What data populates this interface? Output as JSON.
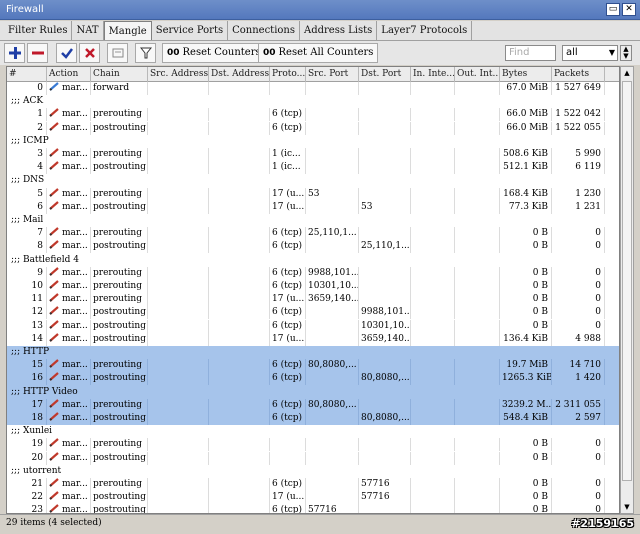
{
  "window": {
    "title": "Firewall"
  },
  "tabs": [
    {
      "label": "Filter Rules",
      "active": false
    },
    {
      "label": "NAT",
      "active": false
    },
    {
      "label": "Mangle",
      "active": true
    },
    {
      "label": "Service Ports",
      "active": false
    },
    {
      "label": "Connections",
      "active": false
    },
    {
      "label": "Address Lists",
      "active": false
    },
    {
      "label": "Layer7 Protocols",
      "active": false
    }
  ],
  "toolbar": {
    "reset_counters_badge": "00",
    "reset_counters_label": "Reset Counters",
    "reset_all_badge": "00",
    "reset_all_label": "Reset All Counters",
    "find_placeholder": "Find",
    "filter_value": "all"
  },
  "columns": [
    "#",
    "Action",
    "Chain",
    "Src. Address",
    "Dst. Address",
    "Proto...",
    "Src. Port",
    "Dst. Port",
    "In. Inte...",
    "Out. Int...",
    "Bytes",
    "Packets"
  ],
  "rows": [
    {
      "type": "rule",
      "num": "0",
      "action": "mar...",
      "chain": "forward",
      "proto": "",
      "src_port": "",
      "dst_port": "",
      "bytes": "67.0 MiB",
      "packets": "1 527 649",
      "selected": false,
      "icon": "blue"
    },
    {
      "type": "comment",
      "text": ";;; ACK",
      "selected": false
    },
    {
      "type": "rule",
      "num": "1",
      "action": "mar...",
      "chain": "prerouting",
      "proto": "6 (tcp)",
      "src_port": "",
      "dst_port": "",
      "bytes": "66.0 MiB",
      "packets": "1 522 042",
      "selected": false
    },
    {
      "type": "rule",
      "num": "2",
      "action": "mar...",
      "chain": "postrouting",
      "proto": "6 (tcp)",
      "src_port": "",
      "dst_port": "",
      "bytes": "66.0 MiB",
      "packets": "1 522 055",
      "selected": false
    },
    {
      "type": "comment",
      "text": ";;; ICMP",
      "selected": false
    },
    {
      "type": "rule",
      "num": "3",
      "action": "mar...",
      "chain": "prerouting",
      "proto": "1 (ic...",
      "src_port": "",
      "dst_port": "",
      "bytes": "508.6 KiB",
      "packets": "5 990",
      "selected": false
    },
    {
      "type": "rule",
      "num": "4",
      "action": "mar...",
      "chain": "postrouting",
      "proto": "1 (ic...",
      "src_port": "",
      "dst_port": "",
      "bytes": "512.1 KiB",
      "packets": "6 119",
      "selected": false
    },
    {
      "type": "comment",
      "text": ";;; DNS",
      "selected": false
    },
    {
      "type": "rule",
      "num": "5",
      "action": "mar...",
      "chain": "prerouting",
      "proto": "17 (u...",
      "src_port": "53",
      "dst_port": "",
      "bytes": "168.4 KiB",
      "packets": "1 230",
      "selected": false
    },
    {
      "type": "rule",
      "num": "6",
      "action": "mar...",
      "chain": "postrouting",
      "proto": "17 (u...",
      "src_port": "",
      "dst_port": "53",
      "bytes": "77.3 KiB",
      "packets": "1 231",
      "selected": false
    },
    {
      "type": "comment",
      "text": ";;; Mail",
      "selected": false
    },
    {
      "type": "rule",
      "num": "7",
      "action": "mar...",
      "chain": "prerouting",
      "proto": "6 (tcp)",
      "src_port": "25,110,1...",
      "dst_port": "",
      "bytes": "0 B",
      "packets": "0",
      "selected": false
    },
    {
      "type": "rule",
      "num": "8",
      "action": "mar...",
      "chain": "postrouting",
      "proto": "6 (tcp)",
      "src_port": "",
      "dst_port": "25,110,1...",
      "bytes": "0 B",
      "packets": "0",
      "selected": false
    },
    {
      "type": "comment",
      "text": ";;; Battlefield 4",
      "selected": false
    },
    {
      "type": "rule",
      "num": "9",
      "action": "mar...",
      "chain": "prerouting",
      "proto": "6 (tcp)",
      "src_port": "9988,101...",
      "dst_port": "",
      "bytes": "0 B",
      "packets": "0",
      "selected": false
    },
    {
      "type": "rule",
      "num": "10",
      "action": "mar...",
      "chain": "prerouting",
      "proto": "6 (tcp)",
      "src_port": "10301,10...",
      "dst_port": "",
      "bytes": "0 B",
      "packets": "0",
      "selected": false
    },
    {
      "type": "rule",
      "num": "11",
      "action": "mar...",
      "chain": "prerouting",
      "proto": "17 (u...",
      "src_port": "3659,140...",
      "dst_port": "",
      "bytes": "0 B",
      "packets": "0",
      "selected": false
    },
    {
      "type": "rule",
      "num": "12",
      "action": "mar...",
      "chain": "postrouting",
      "proto": "6 (tcp)",
      "src_port": "",
      "dst_port": "9988,101...",
      "bytes": "0 B",
      "packets": "0",
      "selected": false
    },
    {
      "type": "rule",
      "num": "13",
      "action": "mar...",
      "chain": "postrouting",
      "proto": "6 (tcp)",
      "src_port": "",
      "dst_port": "10301,10...",
      "bytes": "0 B",
      "packets": "0",
      "selected": false
    },
    {
      "type": "rule",
      "num": "14",
      "action": "mar...",
      "chain": "postrouting",
      "proto": "17 (u...",
      "src_port": "",
      "dst_port": "3659,140...",
      "bytes": "136.4 KiB",
      "packets": "4 988",
      "selected": false
    },
    {
      "type": "comment",
      "text": ";;; HTTP",
      "selected": true
    },
    {
      "type": "rule",
      "num": "15",
      "action": "mar...",
      "chain": "prerouting",
      "proto": "6 (tcp)",
      "src_port": "80,8080,...",
      "dst_port": "",
      "bytes": "19.7 MiB",
      "packets": "14 710",
      "selected": true
    },
    {
      "type": "rule",
      "num": "16",
      "action": "mar...",
      "chain": "postrouting",
      "proto": "6 (tcp)",
      "src_port": "",
      "dst_port": "80,8080,...",
      "bytes": "1265.3 KiB",
      "packets": "1 420",
      "selected": true
    },
    {
      "type": "comment",
      "text": ";;; HTTP Video",
      "selected": true
    },
    {
      "type": "rule",
      "num": "17",
      "action": "mar...",
      "chain": "prerouting",
      "proto": "6 (tcp)",
      "src_port": "80,8080,...",
      "dst_port": "",
      "bytes": "3239.2 M...",
      "packets": "2 311 055",
      "selected": true
    },
    {
      "type": "rule",
      "num": "18",
      "action": "mar...",
      "chain": "postrouting",
      "proto": "6 (tcp)",
      "src_port": "",
      "dst_port": "80,8080,...",
      "bytes": "548.4 KiB",
      "packets": "2 597",
      "selected": true
    },
    {
      "type": "comment",
      "text": ";;; Xunlei",
      "selected": false
    },
    {
      "type": "rule",
      "num": "19",
      "action": "mar...",
      "chain": "prerouting",
      "proto": "",
      "src_port": "",
      "dst_port": "",
      "bytes": "0 B",
      "packets": "0",
      "selected": false
    },
    {
      "type": "rule",
      "num": "20",
      "action": "mar...",
      "chain": "postrouting",
      "proto": "",
      "src_port": "",
      "dst_port": "",
      "bytes": "0 B",
      "packets": "0",
      "selected": false
    },
    {
      "type": "comment",
      "text": ";;; utorrent",
      "selected": false
    },
    {
      "type": "rule",
      "num": "21",
      "action": "mar...",
      "chain": "prerouting",
      "proto": "6 (tcp)",
      "src_port": "",
      "dst_port": "57716",
      "bytes": "0 B",
      "packets": "0",
      "selected": false
    },
    {
      "type": "rule",
      "num": "22",
      "action": "mar...",
      "chain": "postrouting",
      "proto": "17 (u...",
      "src_port": "",
      "dst_port": "57716",
      "bytes": "0 B",
      "packets": "0",
      "selected": false
    },
    {
      "type": "rule",
      "num": "23",
      "action": "mar...",
      "chain": "postrouting",
      "proto": "6 (tcp)",
      "src_port": "57716",
      "dst_port": "",
      "bytes": "0 B",
      "packets": "0",
      "selected": false
    }
  ],
  "status": {
    "text": "29 items (4 selected)",
    "watermark": "#2159165"
  },
  "colors": {
    "selection": "#a6c4eb",
    "title_bar": "#5f80c3",
    "add": "#1f3fa6",
    "remove": "#c0192a"
  }
}
